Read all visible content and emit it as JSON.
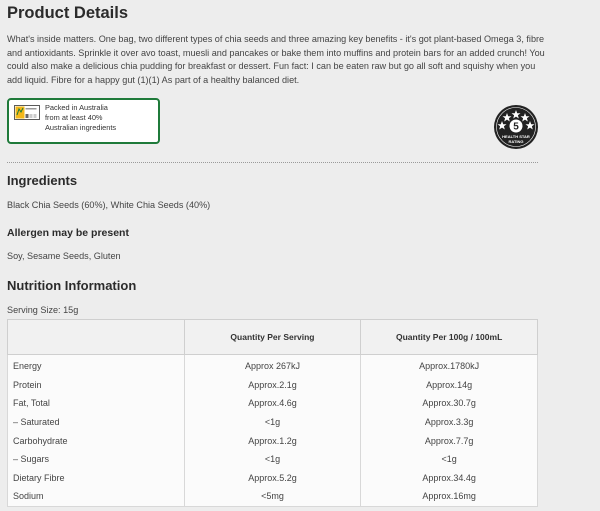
{
  "page_title": "Product Details",
  "description": "What's inside matters. One bag, two different types of chia seeds and three amazing key benefits - it's got plant-based Omega 3, fibre and antioxidants. Sprinkle it over avo toast, muesli and pancakes or bake them into muffins and protein bars for an added crunch! You could also make a delicious chia pudding for breakfast or dessert. Fun fact: I can be eaten raw but go all soft and squishy when you add liquid. Fibre for a happy gut (1)(1) As part of a healthy balanced diet.",
  "aus_badge": {
    "line1": "Packed in Australia",
    "line2": "from at least 40%",
    "line3": "Australian ingredients"
  },
  "health_star": {
    "rating": "5",
    "line1": "HEALTH STAR",
    "line2": "RATING"
  },
  "ingredients": {
    "heading": "Ingredients",
    "text": "Black Chia Seeds (60%), White Chia Seeds (40%)"
  },
  "allergen": {
    "heading": "Allergen may be present",
    "text": "Soy, Sesame Seeds, Gluten"
  },
  "nutrition": {
    "heading": "Nutrition Information",
    "serving_size": "Serving Size: 15g",
    "columns": [
      "",
      "Quantity Per Serving",
      "Quantity Per 100g / 100mL"
    ],
    "rows": [
      {
        "name": "Energy",
        "per_serving": "Approx 267kJ",
        "per_100": "Approx.1780kJ"
      },
      {
        "name": "Protein",
        "per_serving": "Approx.2.1g",
        "per_100": "Approx.14g"
      },
      {
        "name": "Fat, Total",
        "per_serving": "Approx.4.6g",
        "per_100": "Approx.30.7g"
      },
      {
        "name": "– Saturated",
        "per_serving": "<1g",
        "per_100": "Approx.3.3g"
      },
      {
        "name": "Carbohydrate",
        "per_serving": "Approx.1.2g",
        "per_100": "Approx.7.7g"
      },
      {
        "name": "– Sugars",
        "per_serving": "<1g",
        "per_100": "<1g"
      },
      {
        "name": "Dietary Fibre",
        "per_serving": "Approx.5.2g",
        "per_100": "Approx.34.4g"
      },
      {
        "name": "Sodium",
        "per_serving": "<5mg",
        "per_100": "Approx.16mg"
      }
    ]
  },
  "colors": {
    "background": "#ededed",
    "badge_border": "#1f7a3a",
    "health_star_bg": "#222222"
  }
}
